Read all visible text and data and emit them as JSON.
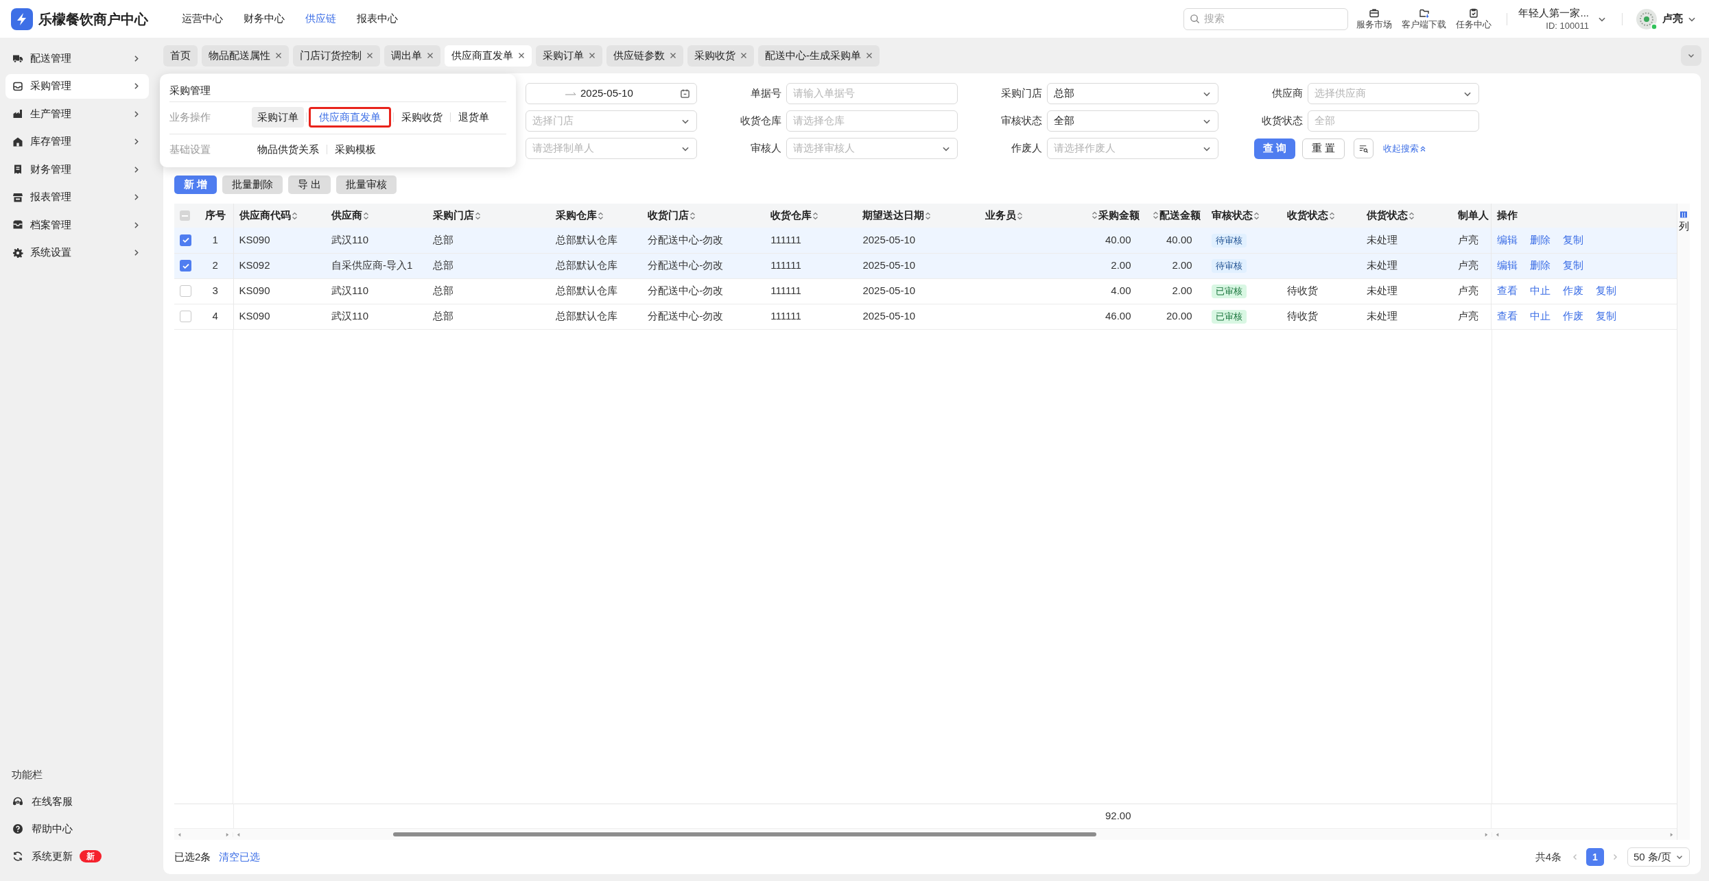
{
  "app": {
    "name": "乐檬餐饮商户中心"
  },
  "top_nav": [
    {
      "label": "运营中心",
      "selected": false
    },
    {
      "label": "财务中心",
      "selected": false
    },
    {
      "label": "供应链",
      "selected": true
    },
    {
      "label": "报表中心",
      "selected": false
    }
  ],
  "search": {
    "placeholder": "搜索"
  },
  "top_actions": [
    {
      "label": "服务市场"
    },
    {
      "label": "客户端下载"
    },
    {
      "label": "任务中心"
    }
  ],
  "account": {
    "org": "年轻人第一家...",
    "id": "ID: 100011",
    "user": "卢亮"
  },
  "sidebar": {
    "items": [
      {
        "label": "配送管理",
        "selected": false
      },
      {
        "label": "采购管理",
        "selected": true
      },
      {
        "label": "生产管理",
        "selected": false
      },
      {
        "label": "库存管理",
        "selected": false
      },
      {
        "label": "财务管理",
        "selected": false
      },
      {
        "label": "报表管理",
        "selected": false
      },
      {
        "label": "档案管理",
        "selected": false
      },
      {
        "label": "系统设置",
        "selected": false
      }
    ],
    "footer_title": "功能栏",
    "footer_items": [
      {
        "label": "在线客服"
      },
      {
        "label": "帮助中心"
      },
      {
        "label": "系统更新",
        "badge": "新"
      }
    ]
  },
  "tabs": [
    {
      "label": "首页",
      "selected": false,
      "closable": false
    },
    {
      "label": "物品配送属性",
      "selected": false,
      "closable": true
    },
    {
      "label": "门店订货控制",
      "selected": false,
      "closable": true
    },
    {
      "label": "调出单",
      "selected": false,
      "closable": true
    },
    {
      "label": "供应商直发单",
      "selected": true,
      "closable": true
    },
    {
      "label": "采购订单",
      "selected": false,
      "closable": true
    },
    {
      "label": "供应链参数",
      "selected": false,
      "closable": true
    },
    {
      "label": "采购收货",
      "selected": false,
      "closable": true
    },
    {
      "label": "配送中心-生成采购单",
      "selected": false,
      "closable": true
    }
  ],
  "menu_popup": {
    "title": "采购管理",
    "groups": [
      {
        "label": "业务操作",
        "links": [
          {
            "label": "采购订单",
            "selected": false,
            "hovered": true
          },
          {
            "label": "供应商直发单",
            "selected": true,
            "hovered": false
          },
          {
            "label": "采购收货",
            "selected": false,
            "hovered": false
          },
          {
            "label": "退货单",
            "selected": false,
            "hovered": false
          }
        ]
      },
      {
        "label": "基础设置",
        "links": [
          {
            "label": "物品供货关系",
            "selected": false,
            "hovered": false
          },
          {
            "label": "采购模板",
            "selected": false,
            "hovered": false
          }
        ]
      }
    ]
  },
  "filters": [
    {
      "kind": "date_end",
      "value": "2025-05-10"
    },
    {
      "kind": "input",
      "label": "单据号",
      "placeholder": "请输入单据号"
    },
    {
      "kind": "select",
      "label": "采购门店",
      "value": "总部"
    },
    {
      "kind": "select",
      "label": "供应商",
      "placeholder": "选择供应商"
    },
    {
      "kind": "select",
      "placeholder": "选择门店"
    },
    {
      "kind": "input",
      "label": "收货仓库",
      "placeholder": "请选择仓库"
    },
    {
      "kind": "select",
      "label": "审核状态",
      "value": "全部"
    },
    {
      "kind": "input",
      "label": "收货状态",
      "placeholder": "全部"
    },
    {
      "kind": "select",
      "placeholder": "请选择制单人"
    },
    {
      "kind": "select",
      "label": "审核人",
      "placeholder": "请选择审核人"
    },
    {
      "kind": "select",
      "label": "作废人",
      "placeholder": "请选择作废人"
    }
  ],
  "filter_actions": {
    "query": "查 询",
    "reset": "重 置",
    "collapse": "收起搜索"
  },
  "toolbar": [
    {
      "label": "新 增",
      "kind": "primary"
    },
    {
      "label": "批量删除",
      "kind": "default"
    },
    {
      "label": "导 出",
      "kind": "default"
    },
    {
      "label": "批量审核",
      "kind": "default"
    }
  ],
  "table": {
    "header_indeterminate": true,
    "columns": [
      {
        "label": "序号",
        "sortable": false
      },
      {
        "label": "供应商代码",
        "sortable": true
      },
      {
        "label": "供应商",
        "sortable": true
      },
      {
        "label": "采购门店",
        "sortable": true
      },
      {
        "label": "采购仓库",
        "sortable": true
      },
      {
        "label": "收货门店",
        "sortable": true
      },
      {
        "label": "收货仓库",
        "sortable": true
      },
      {
        "label": "期望送达日期",
        "sortable": true
      },
      {
        "label": "业务员",
        "sortable": true
      },
      {
        "label": "采购金额",
        "sortable": true
      },
      {
        "label": "配送金额",
        "sortable": true
      },
      {
        "label": "审核状态",
        "sortable": true
      },
      {
        "label": "收货状态",
        "sortable": true
      },
      {
        "label": "供货状态",
        "sortable": true
      },
      {
        "label": "制单人",
        "sortable": false
      },
      {
        "label": "操作",
        "sortable": false
      }
    ],
    "rows": [
      {
        "selected": true,
        "no": "1",
        "supplier_code": "KS090",
        "supplier": "武汉110",
        "purchase_store": "总部",
        "purchase_warehouse": "总部默认仓库",
        "receive_store": "分配送中心-勿改",
        "receive_warehouse": "111111",
        "expected_date": "2025-05-10",
        "purchase_amount": "40.00",
        "delivery_amount": "40.00",
        "audit_status": {
          "label": "待审核",
          "kind": "pending"
        },
        "supply_status": "未处理",
        "creator": "卢亮",
        "actions": [
          "编辑",
          "删除",
          "复制"
        ]
      },
      {
        "selected": true,
        "no": "2",
        "supplier_code": "KS092",
        "supplier": "自采供应商-导入1",
        "purchase_store": "总部",
        "purchase_warehouse": "总部默认仓库",
        "receive_store": "分配送中心-勿改",
        "receive_warehouse": "111111",
        "expected_date": "2025-05-10",
        "purchase_amount": "2.00",
        "delivery_amount": "2.00",
        "audit_status": {
          "label": "待审核",
          "kind": "pending"
        },
        "supply_status": "未处理",
        "creator": "卢亮",
        "actions": [
          "编辑",
          "删除",
          "复制"
        ]
      },
      {
        "selected": false,
        "no": "3",
        "supplier_code": "KS090",
        "supplier": "武汉110",
        "purchase_store": "总部",
        "purchase_warehouse": "总部默认仓库",
        "receive_store": "分配送中心-勿改",
        "receive_warehouse": "111111",
        "expected_date": "2025-05-10",
        "purchase_amount": "4.00",
        "delivery_amount": "2.00",
        "audit_status": {
          "label": "已审核",
          "kind": "approved"
        },
        "receive_status": "待收货",
        "supply_status": "未处理",
        "creator": "卢亮",
        "actions": [
          "查看",
          "中止",
          "作废",
          "复制"
        ]
      },
      {
        "selected": false,
        "no": "4",
        "supplier_code": "KS090",
        "supplier": "武汉110",
        "purchase_store": "总部",
        "purchase_warehouse": "总部默认仓库",
        "receive_store": "分配送中心-勿改",
        "receive_warehouse": "111111",
        "expected_date": "2025-05-10",
        "purchase_amount": "46.00",
        "delivery_amount": "20.00",
        "audit_status": {
          "label": "已审核",
          "kind": "approved"
        },
        "receive_status": "待收货",
        "supply_status": "未处理",
        "creator": "卢亮",
        "actions": [
          "查看",
          "中止",
          "作废",
          "复制"
        ]
      }
    ],
    "total_row": {
      "purchase_amount": "92.00"
    },
    "column_settings": "列"
  },
  "footer": {
    "selected_text": "已选2条",
    "clear": "清空已选",
    "total": "共4条",
    "pages": [
      {
        "label": "1",
        "selected": true
      }
    ],
    "page_size": "50 条/页"
  }
}
